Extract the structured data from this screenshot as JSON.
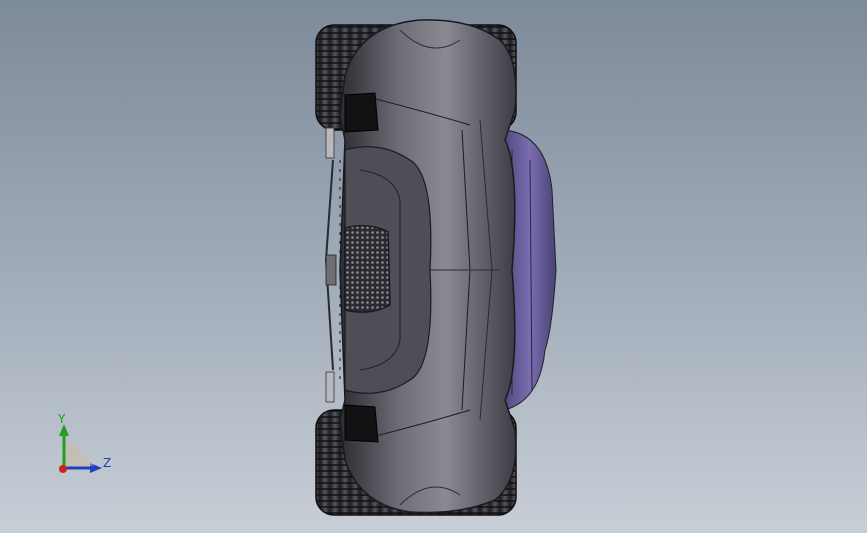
{
  "viewport": {
    "background_top": "#7d8a9a",
    "background_bottom": "#c8ced6",
    "model": "vehicle-front-view-3d",
    "model_body_color": "#5e5e66",
    "model_accent_color": "#6d5f9a"
  },
  "triad": {
    "y_label": "Y",
    "z_label": "Z",
    "y_color": "#1fa01f",
    "z_color": "#1e3fbf",
    "x_color": "#d02020"
  }
}
